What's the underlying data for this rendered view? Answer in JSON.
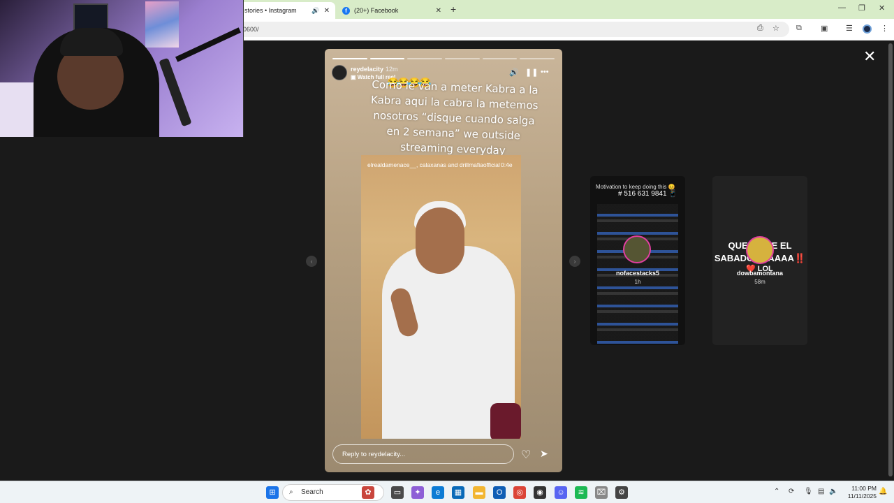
{
  "browser": {
    "tabs": [
      {
        "label": "stories • Instagram",
        "active": true
      },
      {
        "label": "(20+) Facebook",
        "active": false
      }
    ],
    "address": "0600/"
  },
  "story": {
    "username": "reydelacity",
    "time": "12m",
    "watch_full": "Watch full reel",
    "emojis": "😂😂😂😂",
    "caption": "Como le van a meter Kabra a la Kabra aqui la cabra la metemos nosotros “disque cuando salga en 2 semana” we outside streaming everyday",
    "video_credits": "elrealdamenace__, calaxanas and drillmafiaofficial",
    "video_duration": "0:4e",
    "reply_placeholder": "Reply to reydelacity...",
    "progress_total": 6,
    "progress_done": 2
  },
  "previews": [
    {
      "text": "Motivation to keep doing this 😊",
      "number": "# 516 631 9841 📱",
      "name": "nofacestacks5",
      "time": "1h"
    },
    {
      "line1": "QUE VIENE EL",
      "line2": "SABADOOOAAAA‼️",
      "line3": "❤️ LOL",
      "name": "dowbamontana",
      "time": "58m"
    }
  ],
  "taskbar": {
    "search_label": "Search",
    "time": "11:00 PM",
    "date": "11/11/2025"
  },
  "colors": {
    "facebook": "#1877f2",
    "tab_strip": "#d8ecc8",
    "story_ring": "#e13fa0"
  }
}
